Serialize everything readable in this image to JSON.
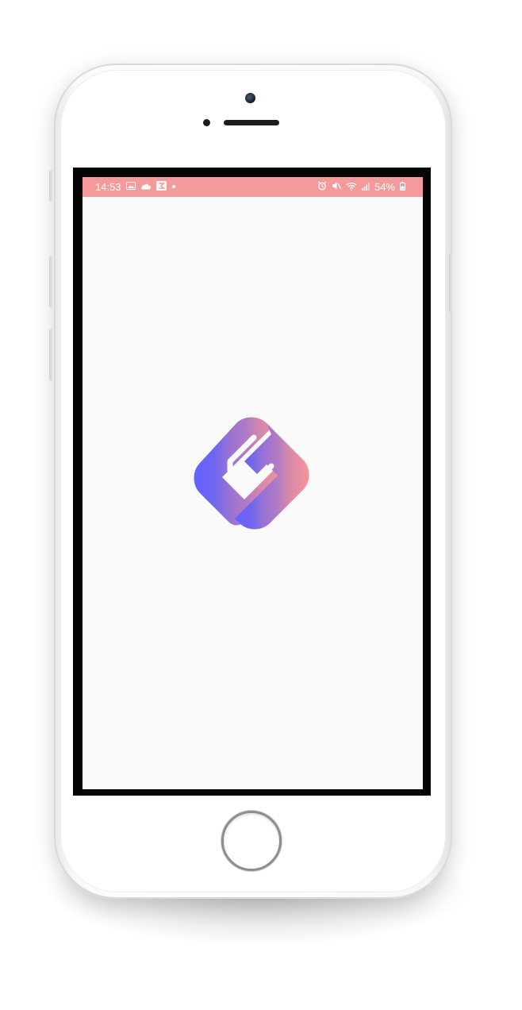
{
  "status_bar": {
    "time": "14:53",
    "battery": "54%",
    "color": "#f49a9a",
    "left_icons": [
      "gallery-icon",
      "cloud-icon",
      "app-notification-icon",
      "dot-icon"
    ],
    "right_icons": [
      "alarm-icon",
      "mute-icon",
      "wifi-icon",
      "signal-icon",
      "battery-icon"
    ]
  },
  "app": {
    "background": "#fafafa",
    "logo": {
      "icon": "app-logo-icon",
      "gradient_colors": [
        "#6462ff",
        "#b27bc3",
        "#f29494"
      ]
    }
  },
  "device": {
    "frame_color": "#ffffff",
    "bezel_color": "#050505"
  }
}
